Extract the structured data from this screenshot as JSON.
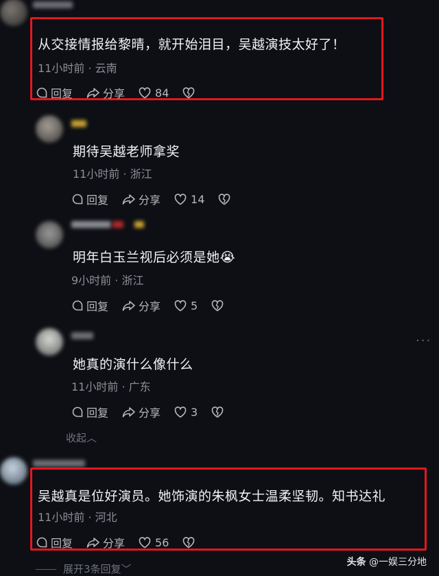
{
  "comments": [
    {
      "text": "从交接情报给黎晴，就开始泪目，吴越演技太好了！",
      "time_location": "11小时前 · 云南",
      "reply_label": "回复",
      "share_label": "分享",
      "likes": "84"
    },
    {
      "text": "期待吴越老师拿奖",
      "time_location": "11小时前 · 浙江",
      "reply_label": "回复",
      "share_label": "分享",
      "likes": "14"
    },
    {
      "text": "明年白玉兰视后必须是她😭",
      "time_location": "9小时前 · 浙江",
      "reply_label": "回复",
      "share_label": "分享",
      "likes": "5"
    },
    {
      "text": "她真的演什么像什么",
      "time_location": "11小时前 · 广东",
      "reply_label": "回复",
      "share_label": "分享",
      "likes": "3"
    },
    {
      "text": "吴越真是位好演员。她饰演的朱枫女士温柔坚韧。知书达礼",
      "time_location": "11小时前 · 河北",
      "reply_label": "回复",
      "share_label": "分享",
      "likes": "56"
    }
  ],
  "collapse_label": "收起",
  "expand_label": "展开3条回复",
  "watermark": {
    "brand": "头条",
    "handle": "@一娱三分地"
  },
  "colors": {
    "background": "#0d0f14",
    "highlight_box": "#e5171e",
    "meta_text": "#8d8f96"
  }
}
